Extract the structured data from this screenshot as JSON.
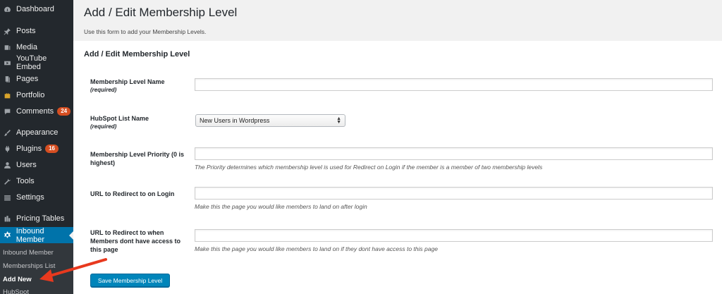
{
  "sidebar": {
    "items": [
      {
        "label": "Dashboard",
        "icon": "dashboard-icon"
      },
      {
        "label": "Posts",
        "icon": "pin-icon"
      },
      {
        "label": "Media",
        "icon": "media-icon"
      },
      {
        "label": "YouTube Embed",
        "icon": "video-icon"
      },
      {
        "label": "Pages",
        "icon": "page-icon"
      },
      {
        "label": "Portfolio",
        "icon": "portfolio-icon"
      },
      {
        "label": "Comments",
        "icon": "comment-icon",
        "badge": "24"
      },
      {
        "label": "Appearance",
        "icon": "brush-icon"
      },
      {
        "label": "Plugins",
        "icon": "plug-icon",
        "badge": "16"
      },
      {
        "label": "Users",
        "icon": "user-icon"
      },
      {
        "label": "Tools",
        "icon": "wrench-icon"
      },
      {
        "label": "Settings",
        "icon": "settings-icon"
      },
      {
        "label": "Pricing Tables",
        "icon": "table-icon"
      },
      {
        "label": "Inbound Member",
        "icon": "gear-icon",
        "active": true
      }
    ],
    "submenu": [
      {
        "label": "Inbound Member"
      },
      {
        "label": "Memberships List"
      },
      {
        "label": "Add New",
        "current": true
      },
      {
        "label": "HubSpot"
      }
    ]
  },
  "page": {
    "title": "Add / Edit Membership Level",
    "description": "Use this form to add your Membership Levels.",
    "section_title": "Add / Edit Membership Level"
  },
  "form": {
    "level_name": {
      "label": "Membership Level Name",
      "required": "(required)",
      "value": ""
    },
    "hubspot_list": {
      "label": "HubSpot List Name",
      "required": "(required)",
      "selected": "New Users in Wordpress"
    },
    "priority": {
      "label": "Membership Level Priority (0 is highest)",
      "value": "",
      "help": "The Priority determines which membership level is used for Redirect on Login if the member is a member of two membership levels"
    },
    "redirect_login": {
      "label": "URL to Redirect to on Login",
      "value": "",
      "help": "Make this the page you would like members to land on after login"
    },
    "redirect_noaccess": {
      "label": "URL to Redirect to when Members dont have access to this page",
      "value": "",
      "help": "Make this the page you would like members to land on if they dont have access to this page"
    },
    "save_label": "Save Membership Level"
  },
  "colors": {
    "sidebar_bg": "#23282d",
    "active_bg": "#0073aa",
    "button_bg": "#0085ba",
    "badge_bg": "#d54e21",
    "annotation_arrow": "#e8391e"
  }
}
